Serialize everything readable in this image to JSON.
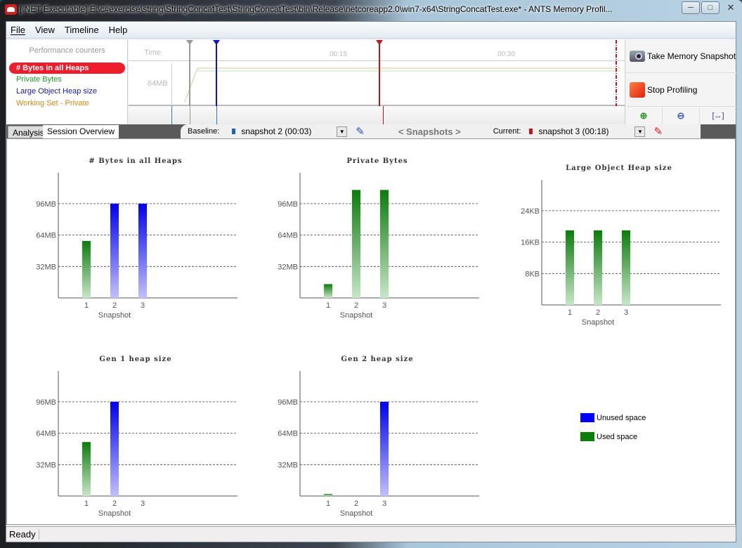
{
  "window": {
    "title": "[.NET Executable] E:\\c#exercise\\string\\StringConcatTest\\StringConcatTest\\bin\\Release\\netcoreapp2.0\\win7-x64\\StringConcatTest.exe* - ANTS Memory Profil...",
    "minimize_icon": "minimize-icon",
    "maximize_icon": "maximize-icon",
    "close_icon": "close-icon"
  },
  "menu": [
    {
      "label": "File",
      "accel": "F"
    },
    {
      "label": "View",
      "accel": "V"
    },
    {
      "label": "Timeline",
      "accel": "l"
    },
    {
      "label": "Help",
      "accel": "H"
    }
  ],
  "counters": {
    "title": "Performance counters",
    "items": [
      {
        "label": "# Bytes in all Heaps",
        "color": "#ffffff",
        "selected": true
      },
      {
        "label": "Private Bytes",
        "color": "#1c9a2a"
      },
      {
        "label": "Large Object Heap size",
        "color": "#1a1ab4"
      },
      {
        "label": "Working Set - Private",
        "color": "#d08a1a"
      }
    ]
  },
  "timeline": {
    "time_label": "Time",
    "ticks": [
      "00:15",
      "00:30"
    ],
    "y_label": "64MB"
  },
  "side": {
    "snapshot_button": "Take Memory Snapshot",
    "stop_button": "Stop Profiling",
    "zoom_in_icon": "zoom-in-icon",
    "zoom_out_icon": "zoom-out-icon",
    "zoom_fit_icon": "zoom-fit-icon"
  },
  "tabs": {
    "analysis": "Analysis",
    "session_overview": "Session Overview"
  },
  "snapbar": {
    "baseline_label": "Baseline:",
    "baseline_value": "snapshot 2 (00:03)",
    "snapshots_nav": "< Snapshots >",
    "current_label": "Current:",
    "current_value": "snapshot 3 (00:18)"
  },
  "colors": {
    "unused": "#0000ff",
    "used": "#0a7d0a",
    "baseline_marker": "#1f5fc8",
    "current_marker": "#c0141e"
  },
  "chart_data": [
    {
      "type": "bar",
      "title": "# Bytes in all Heaps",
      "xlabel": "Snapshot",
      "categories": [
        "1",
        "2",
        "3"
      ],
      "yticks": [
        "32MB",
        "64MB",
        "96MB"
      ],
      "ylim": [
        0,
        128
      ],
      "unit": "MB",
      "series": [
        {
          "name": "bars",
          "values": [
            58,
            96,
            96
          ],
          "kinds": [
            "used",
            "unused",
            "unused"
          ]
        }
      ]
    },
    {
      "type": "bar",
      "title": "Private Bytes",
      "xlabel": "Snapshot",
      "categories": [
        "1",
        "2",
        "3"
      ],
      "yticks": [
        "32MB",
        "64MB",
        "96MB"
      ],
      "ylim": [
        0,
        128
      ],
      "unit": "MB",
      "series": [
        {
          "name": "bars",
          "values": [
            14,
            110,
            110
          ],
          "kinds": [
            "used",
            "used",
            "used"
          ]
        }
      ]
    },
    {
      "type": "bar",
      "title": "Large Object Heap size",
      "xlabel": "Snapshot",
      "categories": [
        "1",
        "2",
        "3"
      ],
      "yticks": [
        "8KB",
        "16KB",
        "24KB"
      ],
      "ylim": [
        0,
        32
      ],
      "unit": "KB",
      "series": [
        {
          "name": "bars",
          "values": [
            19,
            19,
            19
          ],
          "kinds": [
            "used",
            "used",
            "used"
          ]
        }
      ]
    },
    {
      "type": "bar",
      "title": "Gen 1 heap size",
      "xlabel": "Snapshot",
      "categories": [
        "1",
        "2",
        "3"
      ],
      "yticks": [
        "32MB",
        "64MB",
        "96MB"
      ],
      "ylim": [
        0,
        128
      ],
      "unit": "MB",
      "series": [
        {
          "name": "bars",
          "values": [
            55,
            96,
            0
          ],
          "kinds": [
            "used",
            "unused",
            "used"
          ]
        }
      ]
    },
    {
      "type": "bar",
      "title": "Gen 2 heap size",
      "xlabel": "Snapshot",
      "categories": [
        "1",
        "2",
        "3"
      ],
      "yticks": [
        "32MB",
        "64MB",
        "96MB"
      ],
      "ylim": [
        0,
        128
      ],
      "unit": "MB",
      "series": [
        {
          "name": "bars",
          "values": [
            2,
            0,
            96
          ],
          "kinds": [
            "used",
            "used",
            "unused"
          ]
        }
      ]
    }
  ],
  "legend": [
    {
      "label": "Unused space",
      "kind": "unused"
    },
    {
      "label": "Used space",
      "kind": "used"
    }
  ],
  "status": "Ready"
}
